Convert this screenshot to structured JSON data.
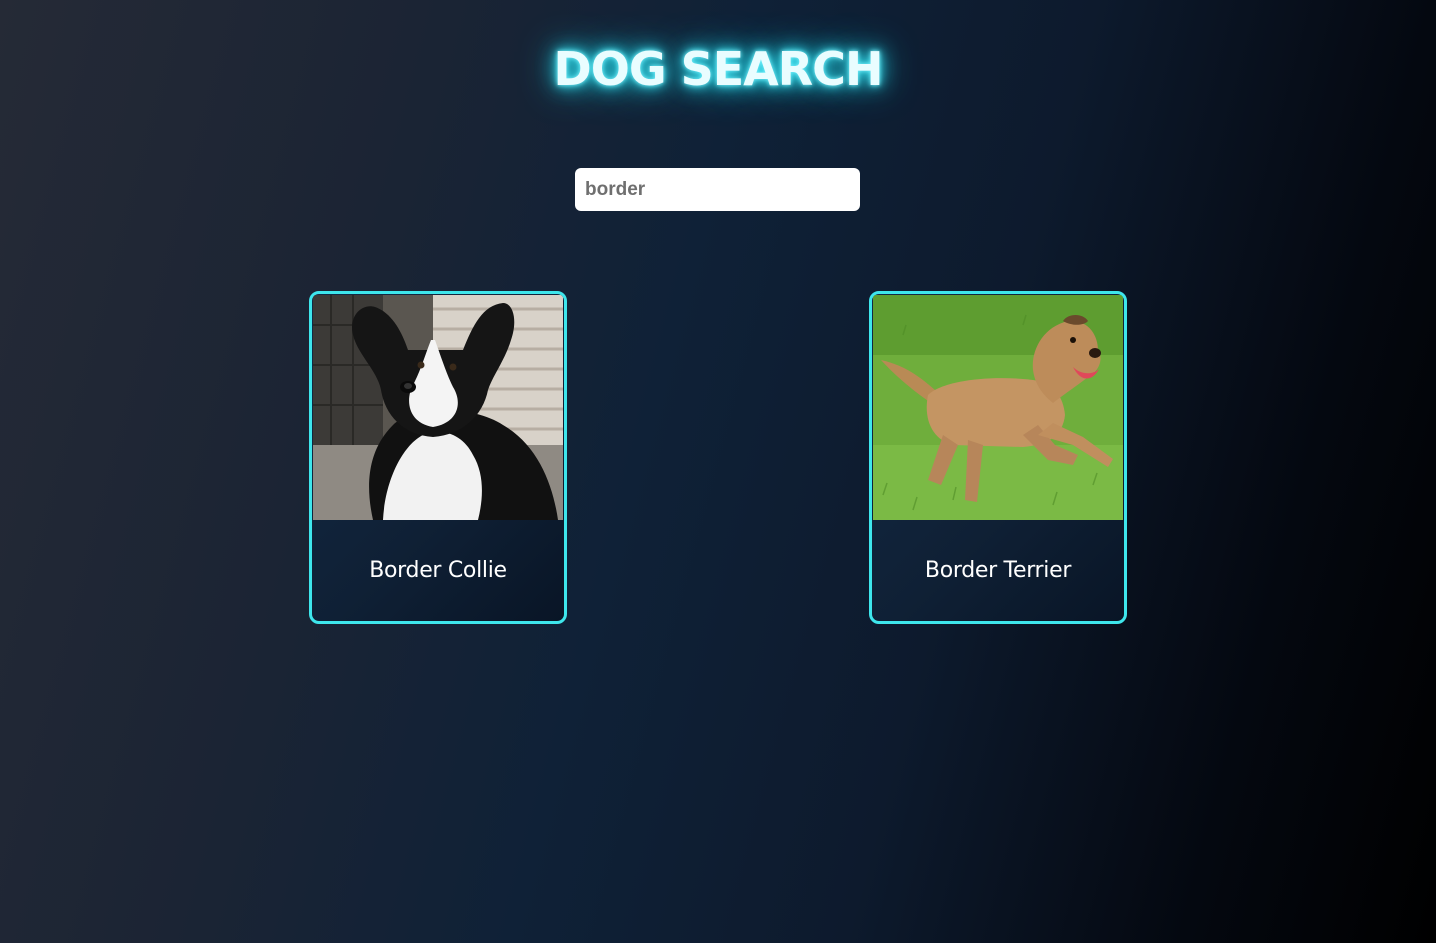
{
  "header": {
    "title": "DOG SEARCH"
  },
  "search": {
    "value": "border"
  },
  "results": [
    {
      "name": "Border Collie",
      "image": "border-collie-photo"
    },
    {
      "name": "Border Terrier",
      "image": "border-terrier-photo"
    }
  ],
  "colors": {
    "accent": "#3ee6ec",
    "title_glow": "#23d3e6",
    "background_dark": "#000000",
    "background_mid": "#0f2137"
  }
}
